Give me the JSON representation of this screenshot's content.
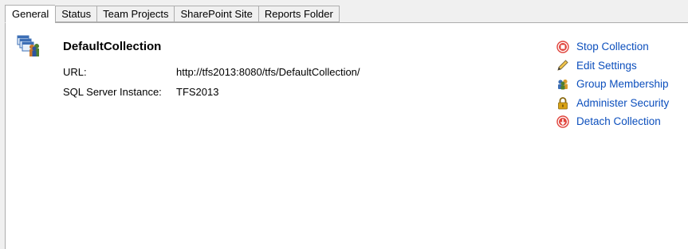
{
  "tabs": [
    {
      "label": "General",
      "active": true
    },
    {
      "label": "Status",
      "active": false
    },
    {
      "label": "Team Projects",
      "active": false
    },
    {
      "label": "SharePoint Site",
      "active": false
    },
    {
      "label": "Reports Folder",
      "active": false
    }
  ],
  "collection": {
    "name": "DefaultCollection",
    "icon": "team-collection-icon",
    "url_label": "URL:",
    "url_value": "http://tfs2013:8080/tfs/DefaultCollection/",
    "sql_label": "SQL Server Instance:",
    "sql_value": "TFS2013"
  },
  "actions": [
    {
      "label": "Stop Collection",
      "icon": "stop-icon"
    },
    {
      "label": "Edit Settings",
      "icon": "pencil-icon"
    },
    {
      "label": "Group Membership",
      "icon": "group-icon"
    },
    {
      "label": "Administer Security",
      "icon": "lock-icon"
    },
    {
      "label": "Detach Collection",
      "icon": "detach-icon"
    }
  ],
  "colors": {
    "link": "#0c4fbd",
    "stop_red": "#e0443c",
    "lock_gold": "#d9a214"
  }
}
